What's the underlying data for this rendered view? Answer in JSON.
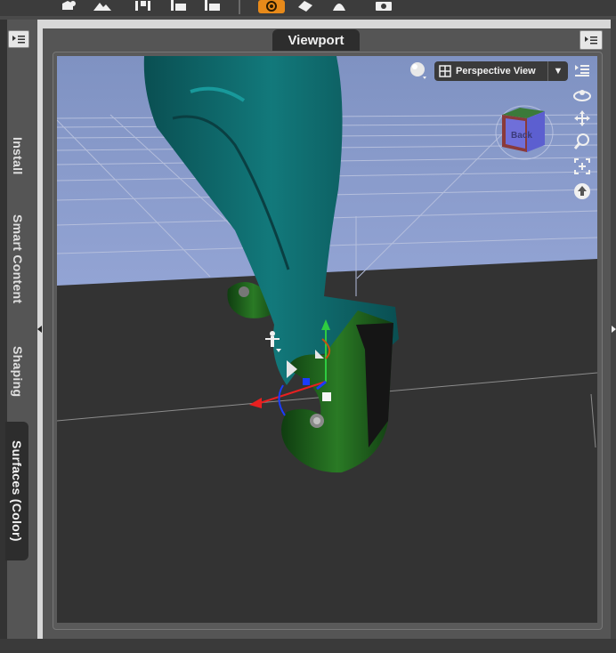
{
  "viewport_tab": {
    "label": "Viewport"
  },
  "side_tabs": [
    {
      "label": "Install",
      "active": false
    },
    {
      "label": "Smart Content",
      "active": false
    },
    {
      "label": "Shaping",
      "active": false
    },
    {
      "label": "Surfaces (Color)",
      "active": true
    }
  ],
  "view_selector": {
    "label": "Perspective View",
    "dropdown": "▼"
  },
  "view_cube": {
    "face_label": "Back"
  },
  "colors": {
    "sky": "#8796c4",
    "floor": "#333333",
    "boot_teal": "#0e6d6f",
    "boot_green": "#1f6b1e",
    "active_tool": "#e88a1a"
  }
}
